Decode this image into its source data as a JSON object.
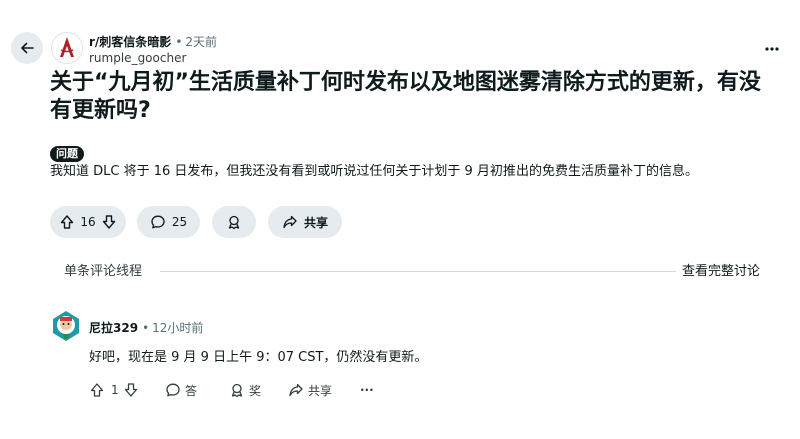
{
  "post": {
    "subreddit": "r/刺客信条暗影",
    "separator": "•",
    "time": "2天前",
    "author": "rumple_goocher",
    "title": "关于“九月初”生活质量补丁何时发布以及地图迷雾清除方式的更新，有没有更新吗?",
    "flair": "问题",
    "body": "我知道 DLC 将于 16 日发布，但我还没有看到或听说过任何关于计划于 9 月初推出的免费生活质量补丁的信息。",
    "votes": "16",
    "comments": "25",
    "share_label": "共享"
  },
  "thread": {
    "label": "单条评论线程",
    "view_all": "查看完整讨论"
  },
  "comment": {
    "author": "尼拉329",
    "separator": "•",
    "time": "12小时前",
    "text": "好吧，现在是 9 月 9 日上午 9：07 CST，仍然没有更新。",
    "votes": "1",
    "reply_label": "答",
    "award_label": "奖",
    "share_label": "共享",
    "more_label": "···"
  },
  "icons": {
    "back": "arrow-left-icon",
    "more": "more-dots-icon",
    "upvote": "upvote-icon",
    "downvote": "downvote-icon",
    "comment": "comment-bubble-icon",
    "award": "award-icon",
    "share": "share-arrow-icon"
  },
  "colors": {
    "pill_bg": "#e5ebee",
    "text": "#0f1a1c",
    "muted": "#576f76",
    "flair_bg": "#0f1a1c",
    "sub_icon": "#b0202a"
  }
}
